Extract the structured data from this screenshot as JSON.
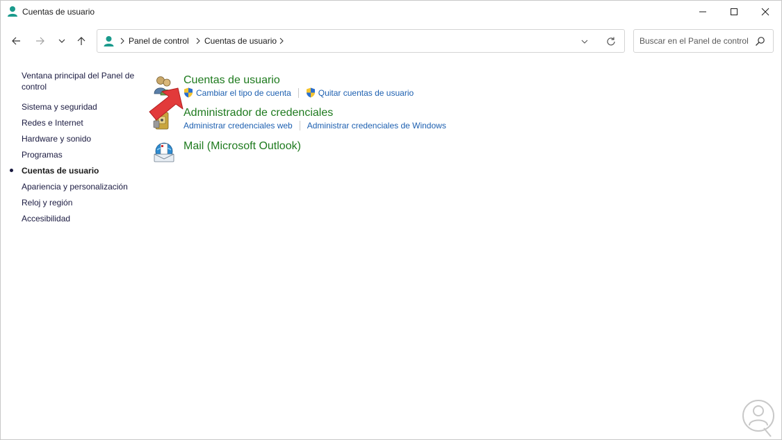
{
  "window": {
    "title": "Cuentas de usuario",
    "controls": {
      "minimize": "minimize-icon",
      "maximize": "maximize-icon",
      "close": "close-icon"
    }
  },
  "nav": {
    "back": "arrow-left-icon",
    "forward": "arrow-right-icon",
    "recent": "chevron-down-icon",
    "up": "arrow-up-icon"
  },
  "address": {
    "breadcrumb": [
      "Panel de control",
      "Cuentas de usuario"
    ]
  },
  "search": {
    "placeholder": "Buscar en el Panel de control"
  },
  "sidebar": {
    "home": "Ventana principal del Panel de control",
    "items": [
      {
        "label": "Sistema y seguridad",
        "active": false
      },
      {
        "label": "Redes e Internet",
        "active": false
      },
      {
        "label": "Hardware y sonido",
        "active": false
      },
      {
        "label": "Programas",
        "active": false
      },
      {
        "label": "Cuentas de usuario",
        "active": true
      },
      {
        "label": "Apariencia y personalización",
        "active": false
      },
      {
        "label": "Reloj y región",
        "active": false
      },
      {
        "label": "Accesibilidad",
        "active": false
      }
    ]
  },
  "categories": [
    {
      "title": "Cuentas de usuario",
      "icon": "user-accounts-icon",
      "links": [
        "Cambiar el tipo de cuenta",
        "Quitar cuentas de usuario"
      ]
    },
    {
      "title": "Administrador de credenciales",
      "icon": "credential-manager-icon",
      "links": [
        "Administrar credenciales web",
        "Administrar credenciales de Windows"
      ]
    },
    {
      "title": "Mail (Microsoft Outlook)",
      "icon": "mail-icon",
      "links": []
    }
  ],
  "colors": {
    "category_title": "#1e7a1e",
    "link": "#1c5fb0",
    "annotation_arrow": "#e23a3a"
  }
}
